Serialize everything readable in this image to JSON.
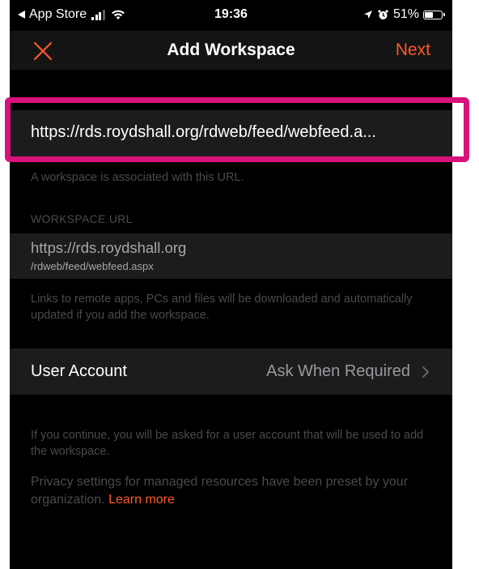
{
  "status_bar": {
    "back_label": "App Store",
    "time": "19:36",
    "battery_percent": "51%",
    "battery_level": 0.51
  },
  "nav": {
    "title": "Add Workspace",
    "next_label": "Next"
  },
  "url_field": {
    "value": "https://rds.royds hall.org/rdweb/feed/webfeed.a..."
  },
  "hint_url": "A workspace is associated with this URL.",
  "workspace_section": {
    "header": "WORKSPACE URL",
    "host": "https://rds.roydshall.org",
    "path": "/rdweb/feed/webfeed.aspx"
  },
  "hint_links": "Links to remote apps, PCs and files will be downloaded and automatically updated if you add the workspace.",
  "account": {
    "label": "User Account",
    "value": "Ask When Required"
  },
  "hint_continue": "If you continue, you will be asked for a user account that will be used to add the workspace.",
  "privacy": {
    "text": "Privacy settings for managed resources have been preset by your organization.",
    "link_label": "Learn more"
  },
  "colors": {
    "accent": "#ff5a2a",
    "highlight": "#d8127a"
  }
}
